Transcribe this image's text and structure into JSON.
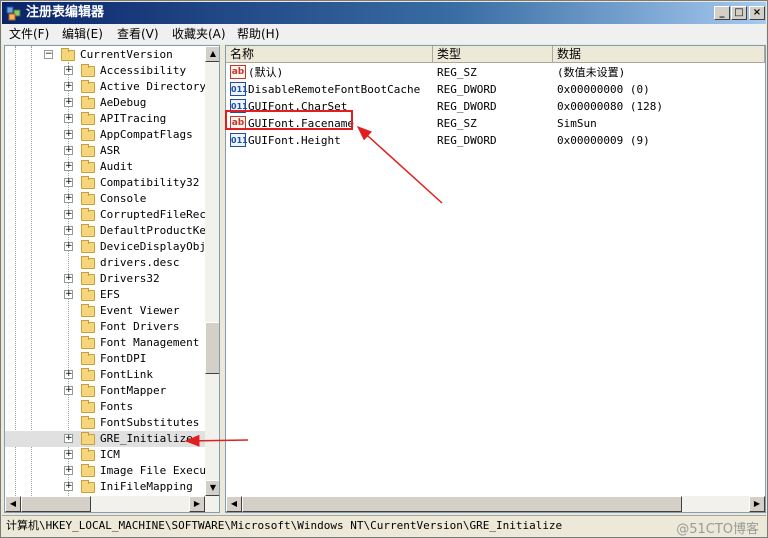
{
  "app": {
    "title": "注册表编辑器",
    "window_buttons": {
      "minimize": "_",
      "maximize": "□",
      "close": "×"
    }
  },
  "menu": [
    "文件(F)",
    "编辑(E)",
    "查看(V)",
    "收藏夹(A)",
    "帮助(H)"
  ],
  "tree": {
    "parent": "CurrentVersion",
    "items": [
      {
        "label": "Accessibility",
        "expandable": true
      },
      {
        "label": "Active Directory",
        "expandable": true
      },
      {
        "label": "AeDebug",
        "expandable": true
      },
      {
        "label": "APITracing",
        "expandable": true
      },
      {
        "label": "AppCompatFlags",
        "expandable": true
      },
      {
        "label": "ASR",
        "expandable": true
      },
      {
        "label": "Audit",
        "expandable": true
      },
      {
        "label": "Compatibility32",
        "expandable": true
      },
      {
        "label": "Console",
        "expandable": true
      },
      {
        "label": "CorruptedFileReco",
        "expandable": true
      },
      {
        "label": "DefaultProductKey",
        "expandable": true
      },
      {
        "label": "DeviceDisplayObje",
        "expandable": true
      },
      {
        "label": "drivers.desc",
        "expandable": false
      },
      {
        "label": "Drivers32",
        "expandable": true
      },
      {
        "label": "EFS",
        "expandable": true
      },
      {
        "label": "Event Viewer",
        "expandable": false
      },
      {
        "label": "Font Drivers",
        "expandable": false
      },
      {
        "label": "Font Management",
        "expandable": false
      },
      {
        "label": "FontDPI",
        "expandable": false
      },
      {
        "label": "FontLink",
        "expandable": true
      },
      {
        "label": "FontMapper",
        "expandable": true
      },
      {
        "label": "Fonts",
        "expandable": false
      },
      {
        "label": "FontSubstitutes",
        "expandable": false
      },
      {
        "label": "GRE_Initialize",
        "expandable": true
      },
      {
        "label": "ICM",
        "expandable": true
      },
      {
        "label": "Image File Execut",
        "expandable": true
      },
      {
        "label": "IniFileMapping",
        "expandable": true
      }
    ]
  },
  "list": {
    "columns": [
      "名称",
      "类型",
      "数据"
    ],
    "rows": [
      {
        "icon": "ab",
        "name": "(默认)",
        "type": "REG_SZ",
        "data": "(数值未设置)"
      },
      {
        "icon": "011",
        "name": "DisableRemoteFontBootCache",
        "type": "REG_DWORD",
        "data": "0x00000000 (0)"
      },
      {
        "icon": "011",
        "name": "GUIFont.CharSet",
        "type": "REG_DWORD",
        "data": "0x00000080 (128)"
      },
      {
        "icon": "ab",
        "name": "GUIFont.Facename",
        "type": "REG_SZ",
        "data": "SimSun"
      },
      {
        "icon": "011",
        "name": "GUIFont.Height",
        "type": "REG_DWORD",
        "data": "0x00000009 (9)"
      }
    ]
  },
  "status": {
    "path": "计算机\\HKEY_LOCAL_MACHINE\\SOFTWARE\\Microsoft\\Windows NT\\CurrentVersion\\GRE_Initialize"
  },
  "watermark": "@51CTO博客",
  "annotation_color": "#e02020"
}
